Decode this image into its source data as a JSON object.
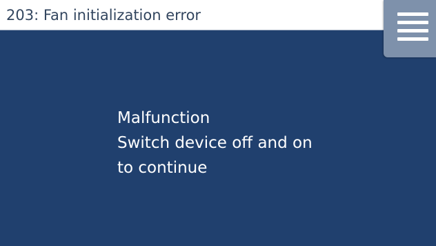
{
  "header": {
    "title": "203: Fan initialization error"
  },
  "menu": {
    "icon": "hamburger-menu-icon"
  },
  "message": {
    "line1": "Malfunction",
    "line2": "Switch device off and on",
    "line3": "to continue"
  },
  "colors": {
    "background": "#20406e",
    "titlebar": "#ffffff",
    "title_text": "#33465f",
    "menu_button": "#7e91ab",
    "message_text": "#ffffff"
  }
}
